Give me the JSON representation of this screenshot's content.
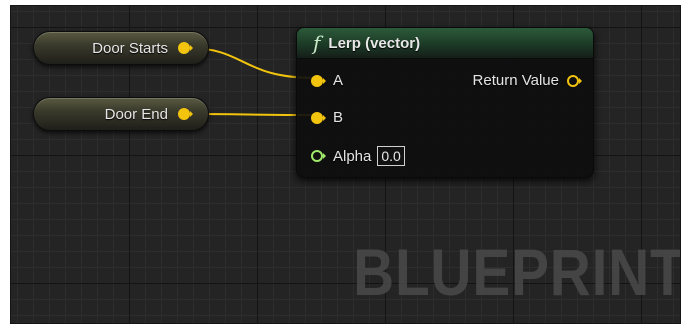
{
  "graph": {
    "watermark": "BLUEPRINT",
    "variables": [
      {
        "label": "Door Starts"
      },
      {
        "label": "Door End"
      }
    ],
    "function_node": {
      "icon": "function-icon",
      "icon_glyph": "f",
      "title": "Lerp (vector)",
      "inputs": [
        {
          "label": "A"
        },
        {
          "label": "B"
        },
        {
          "label": "Alpha",
          "value": "0.0"
        }
      ],
      "output": {
        "label": "Return Value"
      }
    }
  },
  "colors": {
    "vector_pin": "#f2c40e",
    "float_pin": "#a0e86a",
    "wire": "#f2c40e",
    "header": "#2c5a3a"
  }
}
